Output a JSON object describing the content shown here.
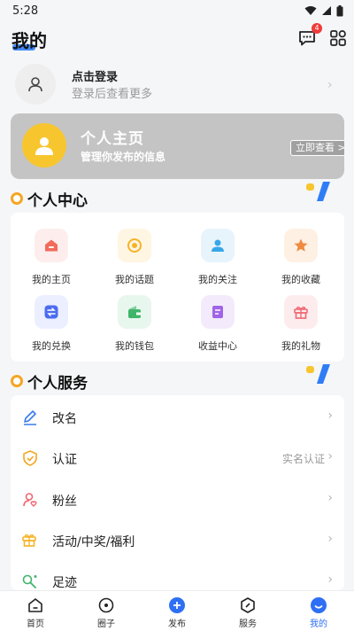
{
  "status_bar": {
    "time": "5:28"
  },
  "header": {
    "title": "我的",
    "message_badge": "4"
  },
  "login": {
    "title": "点击登录",
    "subtitle": "登录后查看更多"
  },
  "banner": {
    "title": "个人主页",
    "subtitle": "管理你发布的信息",
    "button_label": "立即查看 >"
  },
  "personal_center": {
    "title": "个人中心",
    "items": [
      {
        "label": "我的主页",
        "icon": "home-icon",
        "color": "#f26b5b",
        "bg": "#fdeeed"
      },
      {
        "label": "我的话题",
        "icon": "topic-icon",
        "color": "#f5b428",
        "bg": "#fff5e3"
      },
      {
        "label": "我的关注",
        "icon": "follow-user-icon",
        "color": "#38a6e8",
        "bg": "#e7f4fc"
      },
      {
        "label": "我的收藏",
        "icon": "star-icon",
        "color": "#f08a3e",
        "bg": "#fff0e4"
      },
      {
        "label": "我的兑换",
        "icon": "exchange-icon",
        "color": "#4b6cf0",
        "bg": "#ebefff"
      },
      {
        "label": "我的钱包",
        "icon": "wallet-icon",
        "color": "#3fb56a",
        "bg": "#e8f7ee"
      },
      {
        "label": "收益中心",
        "icon": "income-icon",
        "color": "#a064e8",
        "bg": "#f3ebfc"
      },
      {
        "label": "我的礼物",
        "icon": "gift-icon",
        "color": "#f06670",
        "bg": "#fdecee"
      }
    ]
  },
  "personal_service": {
    "title": "个人服务",
    "items": [
      {
        "label": "改名",
        "value": "",
        "icon": "edit-icon",
        "color": "#3a7be8"
      },
      {
        "label": "认证",
        "value": "实名认证",
        "icon": "shield-icon",
        "color": "#f5a623"
      },
      {
        "label": "粉丝",
        "value": "",
        "icon": "fans-icon",
        "color": "#f06670"
      },
      {
        "label": "活动/中奖/福利",
        "value": "",
        "icon": "gift-icon",
        "color": "#f5b428"
      },
      {
        "label": "足迹",
        "value": "",
        "icon": "footprint-icon",
        "color": "#3fb56a"
      }
    ]
  },
  "bottom_nav": {
    "items": [
      {
        "label": "首页",
        "icon": "home-icon"
      },
      {
        "label": "圈子",
        "icon": "circle-icon"
      },
      {
        "label": "发布",
        "icon": "publish-icon"
      },
      {
        "label": "服务",
        "icon": "service-icon"
      },
      {
        "label": "我的",
        "icon": "me-icon",
        "active": true
      }
    ]
  },
  "colors": {
    "accent": "#2f6ff5",
    "section_dot": "#f5a623",
    "banner_bg": "#c4c4c4"
  }
}
